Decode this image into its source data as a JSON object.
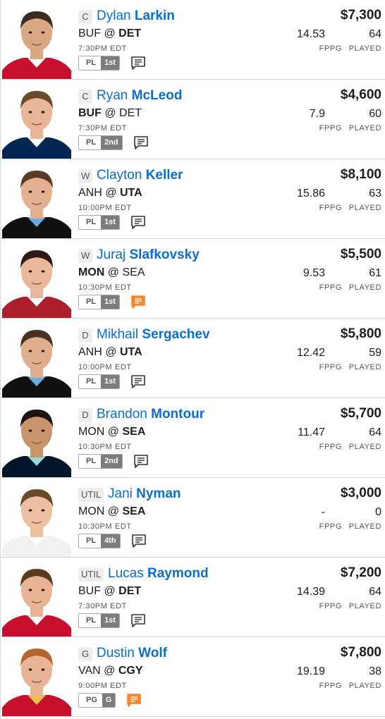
{
  "players": [
    {
      "position": "C",
      "first_name": "Dylan",
      "last_name": "Larkin",
      "salary": "$7,300",
      "team": "BUF",
      "opp": "DET",
      "bold": "away",
      "bold_side": "home",
      "time": "7:30PM EDT",
      "fppg": "14.53",
      "played": "64",
      "badge_left": "PL",
      "badge_right": "1st",
      "note_highlight": false,
      "jersey": "#c8102e",
      "skin": "#d9a882",
      "hair": "#3a2a20",
      "collar": "#ffffff"
    },
    {
      "position": "C",
      "first_name": "Ryan",
      "last_name": "McLeod",
      "salary": "$4,600",
      "team": "BUF",
      "opp": "DET",
      "bold_side": "away",
      "time": "7:30PM EDT",
      "fppg": "7.9",
      "played": "60",
      "badge_left": "PL",
      "badge_right": "2nd",
      "note_highlight": false,
      "jersey": "#002654",
      "skin": "#e6b696",
      "hair": "#6b4a2a",
      "collar": "#ffffff"
    },
    {
      "position": "W",
      "first_name": "Clayton",
      "last_name": "Keller",
      "salary": "$8,100",
      "team": "ANH",
      "opp": "UTA",
      "bold_side": "home",
      "time": "10:00PM EDT",
      "fppg": "15.86",
      "played": "63",
      "badge_left": "PL",
      "badge_right": "1st",
      "note_highlight": false,
      "jersey": "#111111",
      "skin": "#e3b190",
      "hair": "#5a3a22",
      "collar": "#6cace4"
    },
    {
      "position": "W",
      "first_name": "Juraj",
      "last_name": "Slafkovsky",
      "salary": "$5,500",
      "team": "MON",
      "opp": "SEA",
      "bold_side": "away",
      "time": "10:30PM EDT",
      "fppg": "9.53",
      "played": "61",
      "badge_left": "PL",
      "badge_right": "1st",
      "note_highlight": true,
      "jersey": "#af1e2d",
      "skin": "#e8b898",
      "hair": "#2a1c14",
      "collar": "#ffffff"
    },
    {
      "position": "D",
      "first_name": "Mikhail",
      "last_name": "Sergachev",
      "salary": "$5,800",
      "team": "ANH",
      "opp": "UTA",
      "bold_side": "home",
      "time": "10:00PM EDT",
      "fppg": "12.42",
      "played": "59",
      "badge_left": "PL",
      "badge_right": "1st",
      "note_highlight": false,
      "jersey": "#111111",
      "skin": "#e0ae8c",
      "hair": "#4a3020",
      "collar": "#6cace4"
    },
    {
      "position": "D",
      "first_name": "Brandon",
      "last_name": "Montour",
      "salary": "$5,700",
      "team": "MON",
      "opp": "SEA",
      "bold_side": "home",
      "time": "10:30PM EDT",
      "fppg": "11.47",
      "played": "64",
      "badge_left": "PL",
      "badge_right": "2nd",
      "note_highlight": false,
      "jersey": "#001628",
      "skin": "#c9936c",
      "hair": "#1c1410",
      "collar": "#99d9d9"
    },
    {
      "position": "UTIL",
      "first_name": "Jani",
      "last_name": "Nyman",
      "salary": "$3,000",
      "team": "MON",
      "opp": "SEA",
      "bold_side": "home",
      "time": "10:30PM EDT",
      "fppg": "-",
      "played": "0",
      "badge_left": "PL",
      "badge_right": "4th",
      "note_highlight": false,
      "jersey": "#f0f0f0",
      "skin": "#ecc0a0",
      "hair": "#6a4a2a",
      "collar": "#ffffff"
    },
    {
      "position": "UTIL",
      "first_name": "Lucas",
      "last_name": "Raymond",
      "salary": "$7,200",
      "team": "BUF",
      "opp": "DET",
      "bold_side": "home",
      "time": "7:30PM EDT",
      "fppg": "14.39",
      "played": "64",
      "badge_left": "PL",
      "badge_right": "1st",
      "note_highlight": false,
      "jersey": "#c8102e",
      "skin": "#e6b494",
      "hair": "#5a3a1e",
      "collar": "#ffffff"
    },
    {
      "position": "G",
      "first_name": "Dustin",
      "last_name": "Wolf",
      "salary": "$7,800",
      "team": "VAN",
      "opp": "CGY",
      "bold_side": "home",
      "time": "9:00PM EDT",
      "fppg": "19.19",
      "played": "38",
      "badge_left": "PG",
      "badge_right": "G",
      "note_highlight": true,
      "jersey": "#c8102e",
      "skin": "#e9b494",
      "hair": "#b5642a",
      "collar": "#f1be48"
    }
  ],
  "labels": {
    "at": "@",
    "fppg_label": "FPPG",
    "played_label": "PLAYED"
  },
  "colors": {
    "link": "#0a6ed1",
    "note_highlight": "#f5862a",
    "badge_dark": "#7c7c7c"
  },
  "icons": {
    "note": "notes-icon",
    "avatar": "player-headshot"
  }
}
